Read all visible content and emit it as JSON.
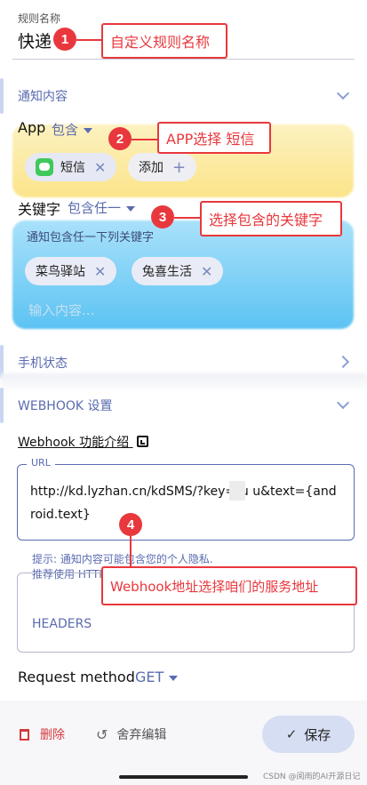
{
  "rule_name": {
    "label": "规则名称",
    "value": "快递"
  },
  "notify": {
    "title": "通知内容",
    "app_label": "App",
    "app_mode": "包含",
    "app_chips": [
      "短信"
    ],
    "add_label": "添加",
    "keyword_label": "关键字",
    "keyword_mode": "包含任一",
    "keyword_hint": "通知包含任一下列关键字",
    "keyword_chips": [
      "菜鸟驿站",
      "兔喜生活"
    ],
    "keyword_placeholder": "输入内容..."
  },
  "phone_state": {
    "title": "手机状态"
  },
  "webhook": {
    "title": "WEBHOOK 设置",
    "intro_link": "Webhook 功能介绍",
    "url_label": "URL",
    "url_value": "http://kd.lyzhan.cn/kdSMS/?key=ru     u&text={android.text}",
    "tip_line1": "提示: 通知内容可能包含您的个人隐私.",
    "tip_line2": "推荐使用 HTTPS 而不是 HTTP.",
    "headers_placeholder": "HEADERS",
    "method_label": "Request method",
    "method_value": "GET"
  },
  "bottom_bar": {
    "delete_label": "删除",
    "discard_label": "舍弃编辑",
    "save_label": "保存"
  },
  "annotations": [
    {
      "num": "1",
      "text": "自定义规则名称"
    },
    {
      "num": "2",
      "text": "APP选择 短信"
    },
    {
      "num": "3",
      "text": "选择包含的关键字"
    },
    {
      "num": "4",
      "text": "Webhook地址选择咱们的服务地址"
    }
  ],
  "watermark": "CSDN @阅雨的AI开源日记",
  "colors": {
    "accent": "#5a6bb0",
    "annotation": "#e8383d",
    "yellow_blur": "#fbe89a",
    "blue_blur": "#7fd0f5",
    "save_bg": "#d6def3"
  }
}
